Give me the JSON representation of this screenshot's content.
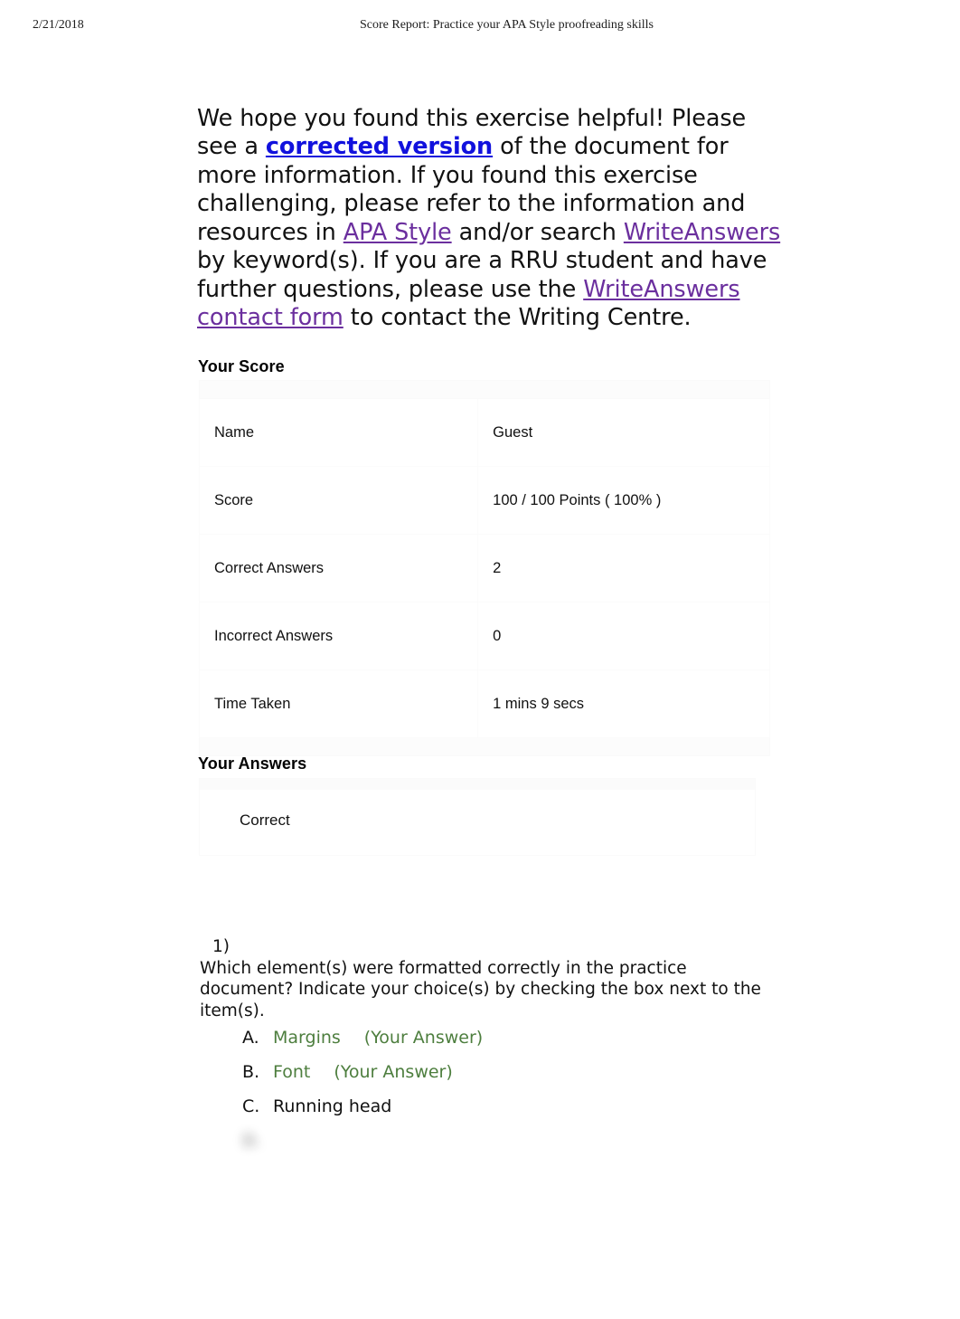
{
  "print_header": {
    "date": "2/21/2018",
    "title": "Score Report: Practice your APA Style proofreading skills"
  },
  "intro": {
    "seg_1": "We hope you found this exercise helpful! Please see a ",
    "link_corrected_version": "corrected version",
    "seg_2": " of the document for more information. If you found this exercise challenging, please refer to the information and resources in ",
    "link_apa_style": "APA Style",
    "seg_3": " and/or search ",
    "link_writeanswers": "WriteAnswers",
    "seg_4": " by keyword(s). If you are a RRU student and have further questions, please use the ",
    "link_contact_form": "WriteAnswers contact form",
    "seg_5": " to contact the Writing Centre."
  },
  "your_score": {
    "heading": "Your Score",
    "rows": [
      {
        "label": "Name",
        "value": "Guest"
      },
      {
        "label": "Score",
        "value": "100 / 100   Points ( 100% )"
      },
      {
        "label": "Correct Answers",
        "value": "2"
      },
      {
        "label": "Incorrect Answers",
        "value": "0"
      },
      {
        "label": "Time Taken",
        "value": "1 mins 9 secs"
      }
    ]
  },
  "your_answers": {
    "heading": "Your Answers",
    "status": "Correct",
    "question": {
      "number": "1)",
      "text": "Which element(s) were formatted correctly in the practice document? Indicate your choice(s) by checking the box next to the item(s).",
      "options": [
        {
          "letter": "A.",
          "text": "Margins",
          "tag": "(Your Answer)",
          "answered": true,
          "blur": 0
        },
        {
          "letter": "B.",
          "text": "Font",
          "tag": "(Your Answer)",
          "answered": true,
          "blur": 0
        },
        {
          "letter": "C.",
          "text": "Running head",
          "tag": "",
          "answered": false,
          "blur": 0
        },
        {
          "letter": "D.",
          "text": "",
          "tag": "",
          "answered": true,
          "blur": 1
        },
        {
          "letter": "",
          "text": "",
          "tag": "",
          "answered": false,
          "blur": 2
        }
      ]
    },
    "tail": ""
  },
  "colors": {
    "link_blue": "#1111dd",
    "link_purple": "#6b2f9e",
    "answer_green": "#4d7e3e",
    "text": "#111111",
    "table_border": "#fbfbfb",
    "page_background": "#ffffff"
  }
}
